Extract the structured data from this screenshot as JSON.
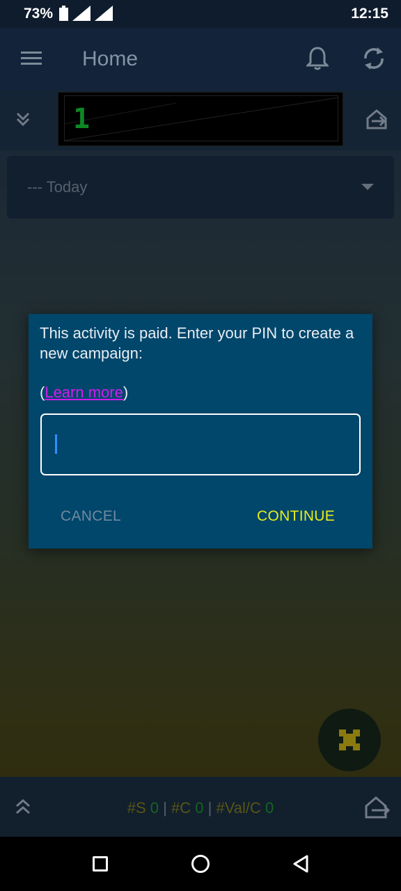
{
  "status_bar": {
    "battery": "73%",
    "time": "12:15"
  },
  "header": {
    "title": "Home"
  },
  "counter": {
    "value": "1"
  },
  "filter": {
    "selected": "--- Today"
  },
  "dialog": {
    "message": "This activity is paid. Enter your PIN to create a new campaign:",
    "learn_more_prefix": "(",
    "learn_more_link": "Learn more",
    "learn_more_suffix": ")",
    "pin_value": "",
    "cancel_label": "CANCEL",
    "continue_label": "CONTINUE"
  },
  "footer": {
    "s_label": "#S",
    "s_value": "0",
    "c_label": "#C",
    "c_value": "0",
    "val_label": "#Val/C",
    "val_value": "0",
    "separator": "|"
  },
  "colors": {
    "dialog_bg": "#01466b",
    "continue": "#e7ee1a",
    "link": "#d21cf0",
    "counter_digit": "#12a62e"
  },
  "icons": [
    "menu-icon",
    "bell-icon",
    "sync-icon",
    "collapse-icon",
    "export-icon",
    "puzzle-icon",
    "expand-icon",
    "home-export-icon",
    "nav-recents-icon",
    "nav-home-icon",
    "nav-back-icon"
  ]
}
